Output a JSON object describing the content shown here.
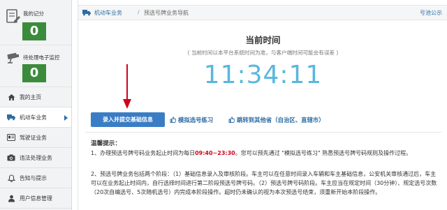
{
  "sidebar": {
    "scores": [
      {
        "label": "我的记分",
        "value": "0",
        "icon": "score-card-icon"
      },
      {
        "label": "待处理电子监控",
        "value": "0",
        "icon": "camera-icon"
      }
    ],
    "items": [
      {
        "label": "我的主页",
        "icon": "home-icon",
        "active": false
      },
      {
        "label": "机动车业务",
        "icon": "truck-icon",
        "active": true
      },
      {
        "label": "驾驶证业务",
        "icon": "license-card-icon",
        "active": false
      },
      {
        "label": "违法处理业务",
        "icon": "camera-icon",
        "active": false
      },
      {
        "label": "告知与提示",
        "icon": "bell-icon",
        "active": false
      },
      {
        "label": "用户信息管理",
        "icon": "user-icon",
        "active": false
      }
    ]
  },
  "header": {
    "breadcrumb_1": "机动车业务",
    "breadcrumb_sep": "/",
    "breadcrumb_2": "预选号牌业务导航",
    "right_link": "号池公示"
  },
  "main": {
    "title": "当前时间",
    "subtitle": "( 当前时间以本平台系统时间为准，与客户端时间可能会有误差 )",
    "clock": "11:34:11",
    "primary_button": "录入并提交基础信息",
    "link_1": "模拟选号练习",
    "link_2": "跳转到其他省（自治区、直辖市）",
    "notice_title": "温馨提示：",
    "para_1_pre": "1、办理预选号牌号码业务起止时间为每日",
    "para_1_time": "09:40~23:30",
    "para_1_post": "。您可以预先通过 \"模拟选号练习\" 熟悉预选号牌号码规则及操作过程。",
    "para_2": "2、预选号牌业务包括两个阶段：（1）基础信息录入及审核阶段。车主可以在任意时间录入车辆和车主基础信息，公安机关审核通过后，车主可以在业务起止时间内，自行选择时间进行第二阶段预选号牌号码。（2）预选号牌号码阶段。车主应当在规定时间（30分钟）、规定选号次数（20次自编选号、5次随机选号）内完成本阶段操作。超时仍未确认的视为本次预选号结束，须重新开始本阶段操作。"
  },
  "colors": {
    "score_green": "#3b8b3d",
    "primary_blue": "#3a7dc4",
    "link_blue": "#2e6da4",
    "clock_blue": "#5ab7dc",
    "alert_red": "#d0021b"
  }
}
